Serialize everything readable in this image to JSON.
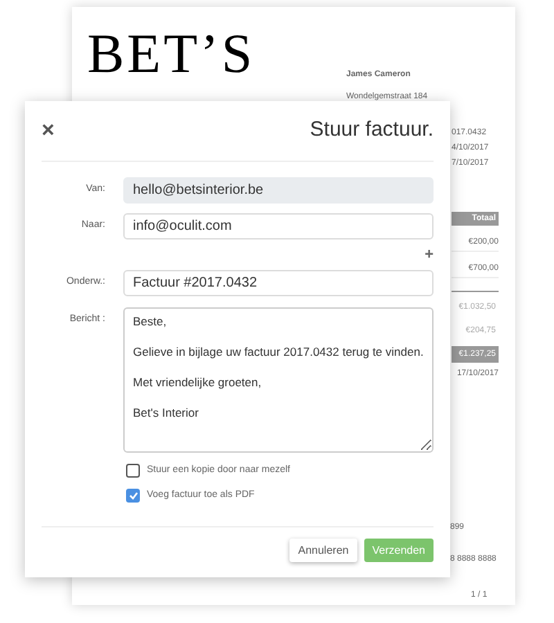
{
  "document": {
    "logo": "BET’S",
    "customer": {
      "name": "James Cameron",
      "street": "Wondelgemstraat 184"
    },
    "details": [
      "017.0432",
      "4/10/2017",
      "7/10/2017"
    ],
    "table": {
      "column": "Totaal",
      "rows": [
        "€200,00",
        "€700,00"
      ]
    },
    "totals": [
      {
        "value": "€1.032,50",
        "highlighted": false
      },
      {
        "value": "€204,75",
        "highlighted": false
      },
      {
        "value": "€1.237,25",
        "highlighted": true
      }
    ],
    "date": "17/10/2017",
    "footer": [
      "899",
      "8 8888 8888"
    ],
    "page": "1 / 1"
  },
  "dialog": {
    "close": "×",
    "title": "Stuur factuur.",
    "fields": [
      {
        "label": "Van:",
        "value": "hello@betsinterior.be",
        "disabled": true
      },
      {
        "label": "Naar:",
        "value": "info@oculit.com",
        "disabled": false
      },
      {
        "label": "Onderw.:",
        "value": "Factuur #2017.0432",
        "disabled": false
      }
    ],
    "add": "+",
    "message": {
      "label": "Bericht :",
      "paragraphs": [
        "Beste,",
        "Gelieve in bijlage uw factuur 2017.0432 terug te vinden.",
        "Met vriendelijke groeten,",
        "Bet's Interior"
      ]
    },
    "options": [
      {
        "label": "Stuur een kopie door naar mezelf",
        "checked": false
      },
      {
        "label": "Voeg factuur toe als PDF",
        "checked": true
      }
    ],
    "buttons": [
      {
        "label": "Annuleren",
        "kind": "secondary"
      },
      {
        "label": "Verzenden",
        "kind": "primary"
      }
    ]
  }
}
